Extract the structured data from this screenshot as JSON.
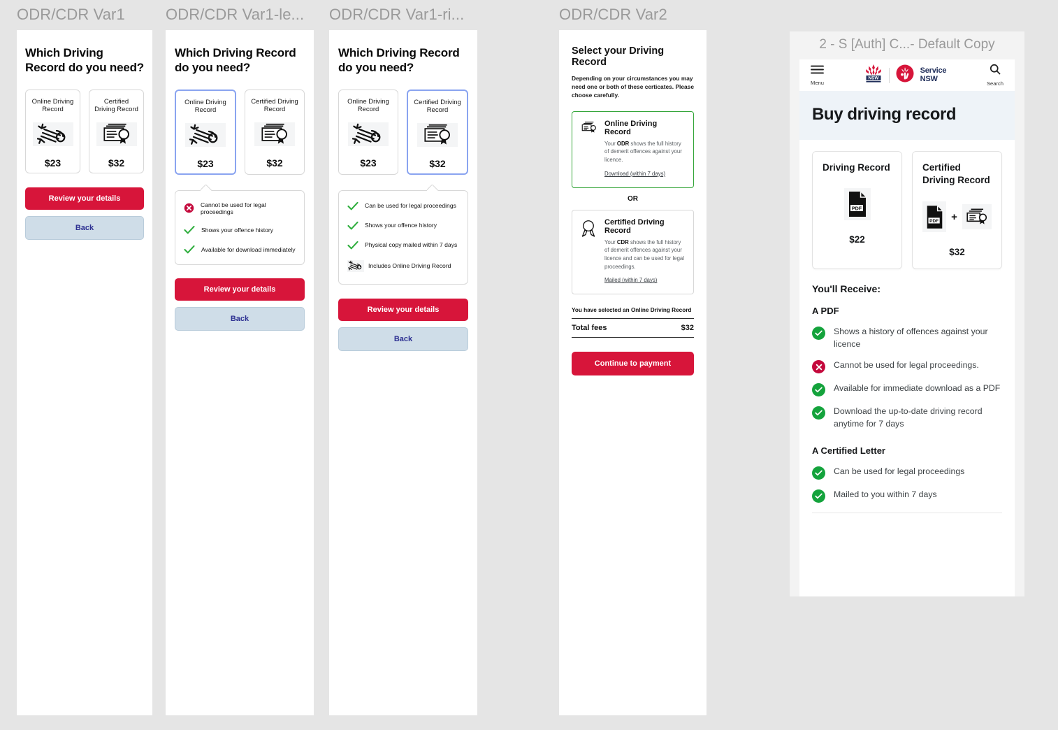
{
  "theme": {
    "canvas_bg": "#e5e5e5",
    "frame_bg": "#ffffff",
    "primary_red": "#d7153a",
    "secondary_blue_bg": "#cfdde8",
    "secondary_blue_text": "#2e3192",
    "selected_border": "#8aa4f0",
    "selected_green": "#35a63a",
    "check_green": "#2fae3e",
    "error_red": "#c4093c",
    "title_grey": "#9a9a9a",
    "hero_bg": "#eef3f8",
    "nsw_red": "#d7153a",
    "nsw_navy": "#22305b"
  },
  "frames": [
    {
      "id": "var1",
      "title": "ODR/CDR Var1"
    },
    {
      "id": "var1-left",
      "title": "ODR/CDR Var1-le..."
    },
    {
      "id": "var1-right",
      "title": "ODR/CDR Var1-ri..."
    },
    {
      "id": "var2",
      "title": "ODR/CDR Var2"
    },
    {
      "id": "servicensw",
      "title": "2 - S [Auth] C...- Default Copy"
    }
  ],
  "var1": {
    "heading": "Which Driving Record do you need?",
    "cards": [
      {
        "title": "Online Driving Record",
        "price": "$23",
        "icon": "scroll-icon",
        "selected": false
      },
      {
        "title": "Certified Driving Record",
        "price": "$32",
        "icon": "certificate-icon",
        "selected": false
      }
    ],
    "primary_button": "Review your details",
    "secondary_button": "Back"
  },
  "var1_left": {
    "heading": "Which Driving Record do you need?",
    "cards": [
      {
        "title": "Online Driving Record",
        "price": "$23",
        "icon": "scroll-icon",
        "selected": true
      },
      {
        "title": "Certified Driving Record",
        "price": "$32",
        "icon": "certificate-icon",
        "selected": false
      }
    ],
    "callout": [
      {
        "icon": "cross-circle-icon",
        "text": "Cannot be used for legal proceedings"
      },
      {
        "icon": "check-icon",
        "text": "Shows your offence history"
      },
      {
        "icon": "check-icon",
        "text": "Available for download immediately"
      }
    ],
    "primary_button": "Review your details",
    "secondary_button": "Back"
  },
  "var1_right": {
    "heading": "Which Driving Record do you need?",
    "cards": [
      {
        "title": "Online Driving Record",
        "price": "$23",
        "icon": "scroll-icon",
        "selected": false
      },
      {
        "title": "Certified Driving Record",
        "price": "$32",
        "icon": "certificate-icon",
        "selected": true
      }
    ],
    "callout": [
      {
        "icon": "check-icon",
        "text": "Can be used for legal proceedings"
      },
      {
        "icon": "check-icon",
        "text": "Shows your offence history"
      },
      {
        "icon": "check-icon",
        "text": "Physical copy mailed within 7 days"
      },
      {
        "icon": "scroll-icon",
        "text": "Includes Online Driving Record"
      }
    ],
    "primary_button": "Review your details",
    "secondary_button": "Back"
  },
  "var2": {
    "heading": "Select your Driving Record",
    "subtext": "Depending on your circumstances you may need one or both of these certicates. Please choose carefully.",
    "options": [
      {
        "icon": "certificate-icon",
        "title": "Online Driving Record",
        "desc_pre": "Your ",
        "desc_bold": "ODR",
        "desc_post": " shows the full history of demerit offences against your licence.",
        "link": "Download (within 7 days)",
        "selected": true
      },
      {
        "icon": "ribbon-icon",
        "title": "Certified Driving Record",
        "desc_pre": "Your ",
        "desc_bold": "CDR",
        "desc_post": " shows the full history of demerit offences against your licence and can be used for legal proceedings.",
        "link": "Mailed (within 7 days)",
        "selected": false
      }
    ],
    "or_label": "OR",
    "selection_note": "You have selected an Online Driving Record",
    "total_label": "Total fees",
    "total_value": "$32",
    "cta_button": "Continue to payment"
  },
  "servicensw": {
    "header": {
      "menu_label": "Menu",
      "search_label": "Search",
      "logo_nsw": "NSW",
      "logo_service_line1": "Service",
      "logo_service_line2": "NSW"
    },
    "hero_title": "Buy driving record",
    "product_cards": [
      {
        "title": "Driving Record",
        "price": "$22",
        "icons": [
          "pdf-icon"
        ]
      },
      {
        "title": "Certified Driving Record",
        "price": "$32",
        "icons": [
          "pdf-icon",
          "plus-icon",
          "certificate-icon"
        ]
      }
    ],
    "receive_heading": "You'll Receive:",
    "sections": [
      {
        "title": "A PDF",
        "items": [
          {
            "status": "ok",
            "text": "Shows a history of offences against your licence"
          },
          {
            "status": "no",
            "text": "Cannot be used for legal proceedings."
          },
          {
            "status": "ok",
            "text": "Available for immediate download as a PDF"
          },
          {
            "status": "ok",
            "text": "Download the up-to-date driving record anytime for 7 days"
          }
        ]
      },
      {
        "title": "A Certified Letter",
        "items": [
          {
            "status": "ok",
            "text": "Can be used for legal proceedings"
          },
          {
            "status": "ok",
            "text": "Mailed to you within 7 days"
          }
        ]
      }
    ]
  }
}
